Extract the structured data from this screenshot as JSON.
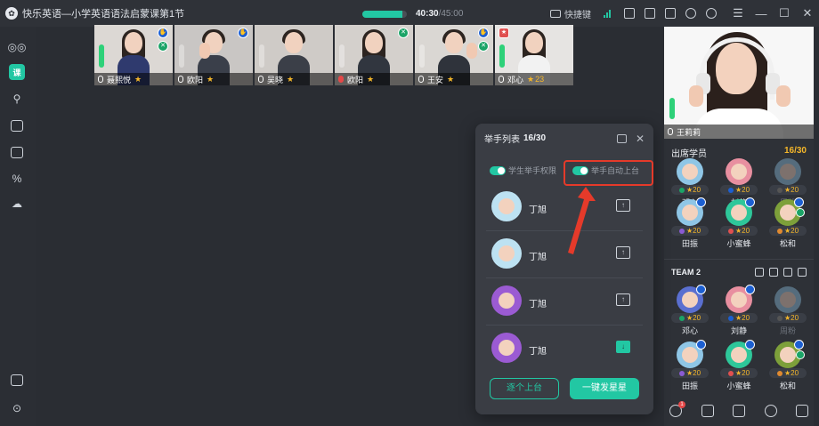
{
  "window": {
    "title": "快乐英语—小学英语语法启蒙课第1节",
    "timer_elapsed": "40:30",
    "timer_total": "/45:00",
    "timer_progress": 0.9,
    "shortcut_label": "快捷键"
  },
  "colors": {
    "accent": "#22c7a3",
    "star": "#f5b72a",
    "highlight": "#e53a2a"
  },
  "leftbar": {
    "active_label": "课",
    "items": [
      "camera-icon",
      "courseware-icon",
      "users-icon",
      "calculator-icon",
      "monitor-icon",
      "percent-bag-icon",
      "cloud-icon",
      "toolbox-icon",
      "settings-icon"
    ]
  },
  "strip": {
    "tiles": [
      {
        "name": "聂熙悦",
        "score": "",
        "mic_off": false
      },
      {
        "name": "欧阳",
        "score": "",
        "mic_off": false
      },
      {
        "name": "吴晓",
        "score": "",
        "mic_off": false
      },
      {
        "name": "欧阳",
        "score": "",
        "mic_off": true
      },
      {
        "name": "王安",
        "score": "",
        "mic_off": false
      },
      {
        "name": "邓心",
        "score": "23",
        "mic_off": false
      }
    ]
  },
  "teacher": {
    "name": "王莉莉"
  },
  "roster": {
    "title": "出席学员",
    "count": "16/30",
    "team1": [
      {
        "name": "邓心",
        "points": "20",
        "dim": false
      },
      {
        "name": "刘静",
        "points": "20",
        "dim": false
      },
      {
        "name": "周粉",
        "points": "20",
        "dim": true
      },
      {
        "name": "田振",
        "points": "20",
        "dim": false
      },
      {
        "name": "小蜜蜂",
        "points": "20",
        "dim": false
      },
      {
        "name": "松和",
        "points": "20",
        "dim": false
      }
    ],
    "team2_name": "TEAM 2",
    "team2": [
      {
        "name": "邓心",
        "points": "20",
        "dim": false
      },
      {
        "name": "刘静",
        "points": "20",
        "dim": false
      },
      {
        "name": "周粉",
        "points": "20",
        "dim": true
      },
      {
        "name": "田振",
        "points": "20",
        "dim": false
      },
      {
        "name": "小蜜蜂",
        "points": "20",
        "dim": false
      },
      {
        "name": "松和",
        "points": "20",
        "dim": false
      }
    ],
    "hand_badge": "1"
  },
  "popup": {
    "title": "举手列表",
    "count": "16/30",
    "toggle_permission": "学生举手权限",
    "toggle_auto": "举手自动上台",
    "rows": [
      {
        "name": "丁旭",
        "on_stage": false
      },
      {
        "name": "丁旭",
        "on_stage": false
      },
      {
        "name": "丁旭",
        "on_stage": false
      },
      {
        "name": "丁旭",
        "on_stage": true
      }
    ],
    "btn_each": "逐个上台",
    "btn_stars": "一键发星星"
  }
}
